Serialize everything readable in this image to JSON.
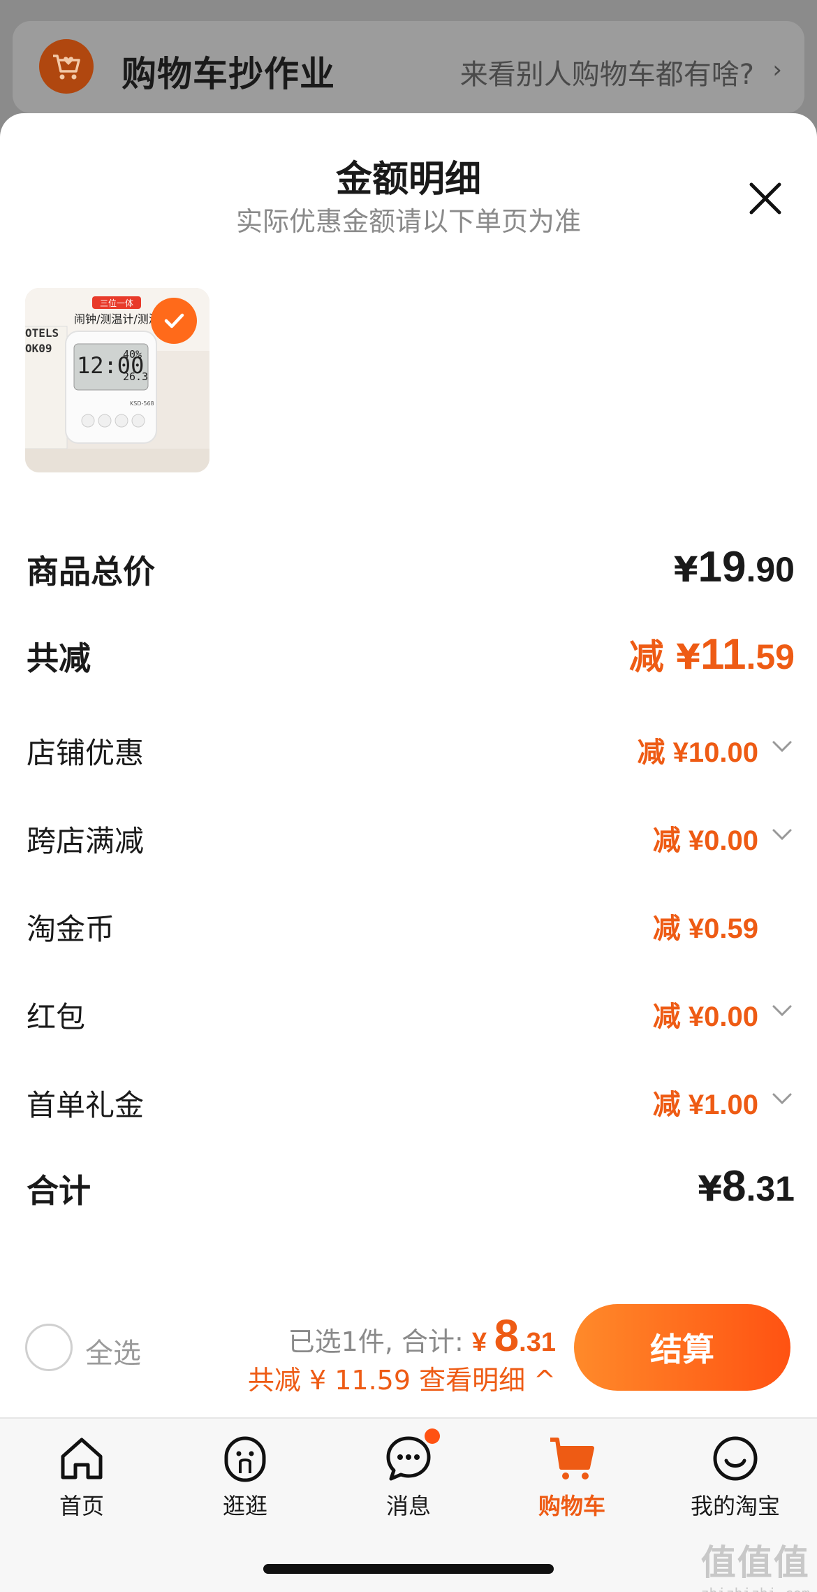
{
  "banner": {
    "title": "购物车抄作业",
    "subtitle": "来看别人购物车都有啥?",
    "chevron": "›"
  },
  "sheet": {
    "title": "金额明细",
    "subtitle": "实际优惠金额请以下单页为准"
  },
  "product_thumb": {
    "tag": "三位一体",
    "caption": "闹钟/测温计/测湿",
    "clock_time": "12:00",
    "humidity": "40%",
    "temperature": "26.3",
    "model": "KSD-568",
    "brand": "OTELS",
    "brand_sub": "OK09",
    "selected": true
  },
  "rows": {
    "total_price": {
      "label": "商品总价",
      "prefix": "¥",
      "int": "19",
      "dec": ".90"
    },
    "total_discount": {
      "label": "共减",
      "prefix": "减 ¥",
      "int": "11",
      "dec": ".59"
    },
    "items": [
      {
        "label": "店铺优惠",
        "value": "减 ¥10.00",
        "has_chevron": true
      },
      {
        "label": "跨店满减",
        "value": "减 ¥0.00",
        "has_chevron": true
      },
      {
        "label": "淘金币",
        "value": "减 ¥0.59",
        "has_chevron": false
      },
      {
        "label": "红包",
        "value": "减 ¥0.00",
        "has_chevron": true
      },
      {
        "label": "首单礼金",
        "value": "减 ¥1.00",
        "has_chevron": true
      }
    ],
    "grand_total": {
      "label": "合计",
      "prefix": "¥",
      "int": "8",
      "dec": ".31"
    }
  },
  "checkout": {
    "select_all_label": "全选",
    "summary_prefix": "已选1件, 合计:",
    "summary_yen": "¥",
    "summary_int": "8",
    "summary_dec": ".31",
    "discount_line": "共减 ¥ 11.59  查看明细 ^",
    "button_label": "结算"
  },
  "tabs": [
    {
      "label": "首页",
      "icon": "home-icon",
      "active": false
    },
    {
      "label": "逛逛",
      "icon": "browse-icon",
      "active": false
    },
    {
      "label": "消息",
      "icon": "message-icon",
      "active": false,
      "badge": true
    },
    {
      "label": "购物车",
      "icon": "cart-icon",
      "active": true
    },
    {
      "label": "我的淘宝",
      "icon": "profile-icon",
      "active": false
    }
  ],
  "watermark": {
    "main": "值值值",
    "sub": "zhizhizhi.com"
  },
  "colors": {
    "accent": "#ee5b14",
    "button_start": "#ff8a2a",
    "button_end": "#ff5212",
    "muted": "#8a8a8a"
  }
}
